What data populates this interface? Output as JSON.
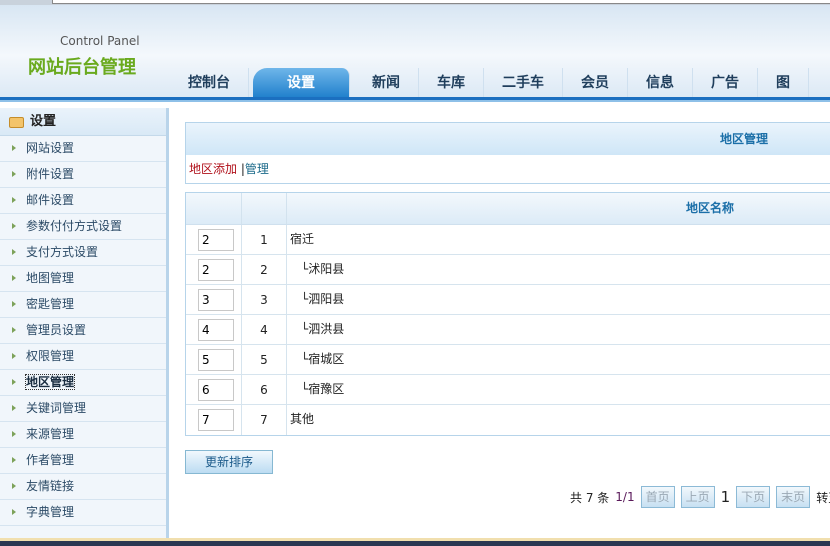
{
  "header": {
    "subtitle": "Control Panel",
    "title": "网站后台管理"
  },
  "nav": [
    {
      "label": "控制台"
    },
    {
      "label": "设置",
      "active": true
    },
    {
      "label": "新闻"
    },
    {
      "label": "车库"
    },
    {
      "label": "二手车"
    },
    {
      "label": "会员"
    },
    {
      "label": "信息"
    },
    {
      "label": "广告"
    },
    {
      "label": "图"
    }
  ],
  "sidebar": {
    "title": "设置",
    "items": [
      "网站设置",
      "附件设置",
      "邮件设置",
      "参数付付方式设置",
      "支付方式设置",
      "地图管理",
      "密匙管理",
      "管理员设置",
      "权限管理",
      "地区管理",
      "关键词管理",
      "来源管理",
      "作者管理",
      "友情链接",
      "字典管理"
    ],
    "active": "地区管理"
  },
  "main": {
    "title": "地区管理",
    "add_link": "地区添加",
    "sep": "|",
    "manage_link": "管理",
    "column_name": "地区名称",
    "rows": [
      {
        "order": "2",
        "id": "1",
        "name": "宿迁",
        "sub": false
      },
      {
        "order": "2",
        "id": "2",
        "name": "└沭阳县",
        "sub": true
      },
      {
        "order": "3",
        "id": "3",
        "name": "└泗阳县",
        "sub": true
      },
      {
        "order": "4",
        "id": "4",
        "name": "└泗洪县",
        "sub": true
      },
      {
        "order": "5",
        "id": "5",
        "name": "└宿城区",
        "sub": true
      },
      {
        "order": "6",
        "id": "6",
        "name": "└宿豫区",
        "sub": true
      },
      {
        "order": "7",
        "id": "7",
        "name": "其他",
        "sub": false
      }
    ],
    "update_button": "更新排序"
  },
  "pager": {
    "total_label": "共 7 条",
    "pages": "1/1",
    "first": "首页",
    "prev": "上页",
    "current": "1",
    "next": "下页",
    "last": "末页",
    "goto": "转至"
  }
}
